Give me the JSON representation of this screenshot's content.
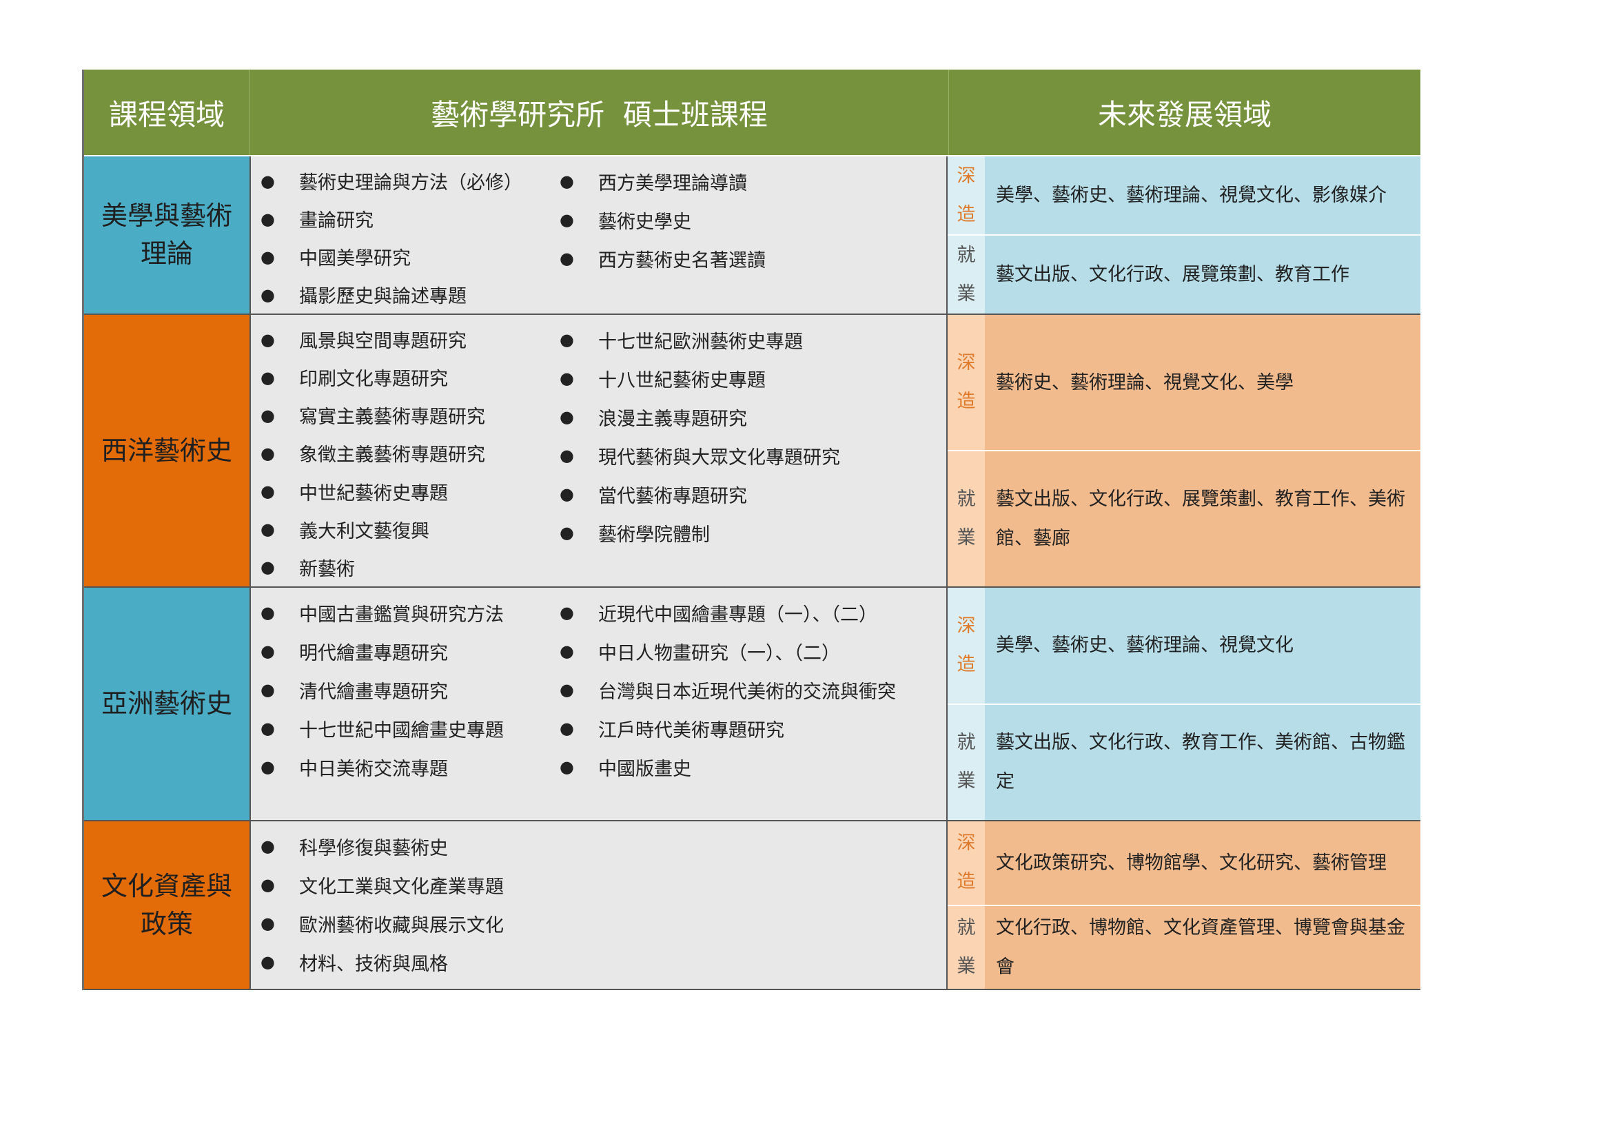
{
  "header": {
    "col_domain": "課程領域",
    "col_courses": "藝術學研究所  碩士班課程",
    "col_future": "未來發展領域"
  },
  "bullet_char": "●",
  "rows": [
    {
      "domain": "美學與藝術\n理論",
      "color": "blue",
      "col1": [
        "藝術史理論與方法（必修）",
        "畫論研究",
        "中國美學研究",
        "攝影歷史與論述專題"
      ],
      "col2": [
        "西方美學理論導讀",
        "藝術史學史",
        "西方藝術史名著選讀"
      ],
      "advanced_label": "深\n造",
      "advanced": "美學、藝術史、藝術理論、視覺文化、影像媒介",
      "career_label": "就\n業",
      "career": "藝文出版、文化行政、展覽策劃、教育工作"
    },
    {
      "domain": "西洋藝術史",
      "color": "orange",
      "col1": [
        "風景與空間專題研究",
        "印刷文化專題研究",
        "寫實主義藝術專題研究",
        "象徵主義藝術專題研究",
        "中世紀藝術史專題",
        "義大利文藝復興",
        "新藝術"
      ],
      "col2": [
        "十七世紀歐洲藝術史專題",
        "十八世紀藝術史專題",
        "浪漫主義專題研究",
        "現代藝術與大眾文化專題研究",
        "當代藝術專題研究",
        "藝術學院體制"
      ],
      "advanced_label": "深\n造",
      "advanced": "藝術史、藝術理論、視覺文化、美學",
      "career_label": "就\n業",
      "career": "藝文出版、文化行政、展覽策劃、教育工作、美術館、藝廊"
    },
    {
      "domain": "亞洲藝術史",
      "color": "blue",
      "col1": [
        "中國古畫鑑賞與研究方法",
        "明代繪畫專題研究",
        "清代繪畫專題研究",
        "十七世紀中國繪畫史專題",
        "中日美術交流專題"
      ],
      "col2": [
        "近現代中國繪畫專題（一）、（二）",
        "中日人物畫研究（一）、（二）",
        "台灣與日本近現代美術的交流與衝突",
        "江戶時代美術專題研究",
        "中國版畫史"
      ],
      "advanced_label": "深\n造",
      "advanced": "美學、藝術史、藝術理論、視覺文化",
      "career_label": "就\n業",
      "career": "藝文出版、文化行政、教育工作、美術館、古物鑑定"
    },
    {
      "domain": "文化資產與\n政策",
      "color": "orange",
      "col1": [
        "科學修復與藝術史",
        "文化工業與文化產業專題",
        "歐洲藝術收藏與展示文化",
        "材料、技術與風格"
      ],
      "col2": [],
      "advanced_label": "深\n造",
      "advanced": "文化政策研究、博物館學、文化研究、藝術管理",
      "career_label": "就\n業",
      "career": "文化行政、博物館、文化資產管理、博覽會與基金會"
    }
  ]
}
